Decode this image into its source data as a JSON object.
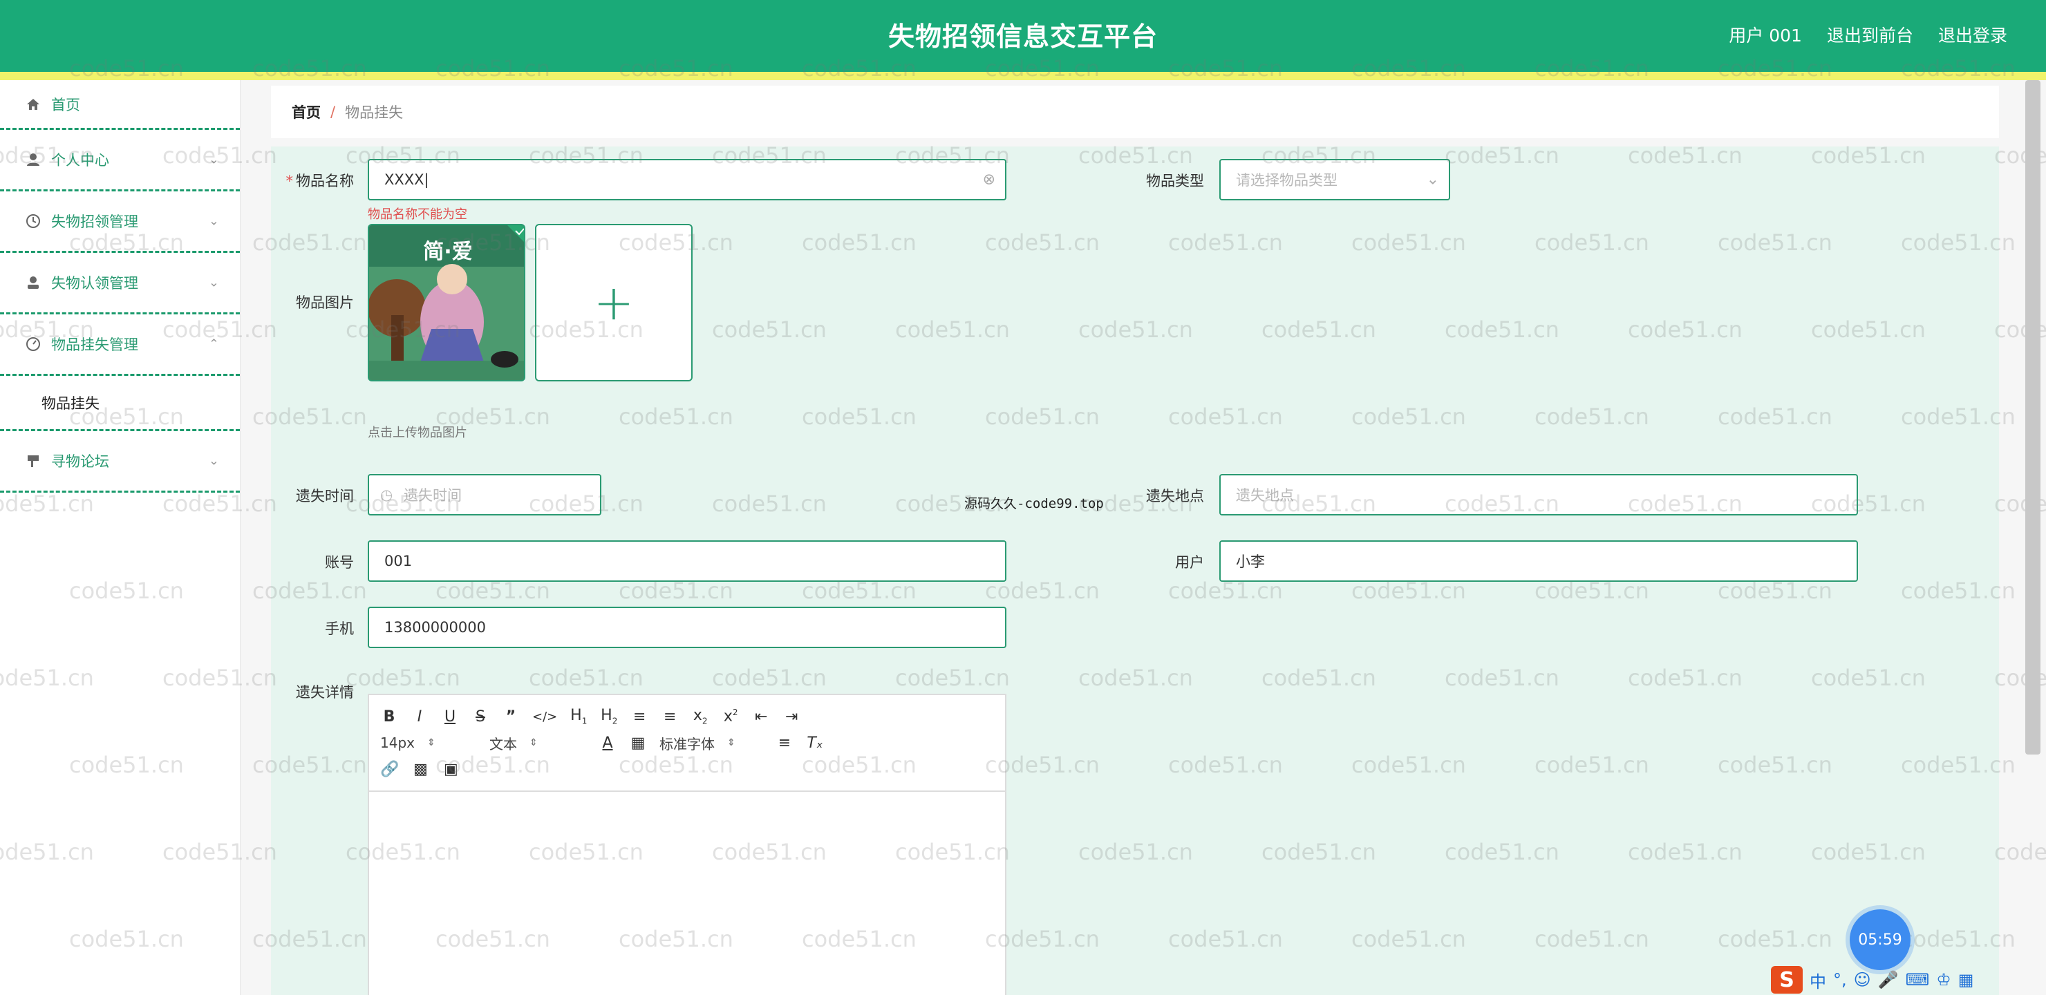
{
  "header": {
    "title": "失物招领信息交互平台",
    "links": [
      "用户 001",
      "退出到前台",
      "退出登录"
    ]
  },
  "sidebar": {
    "items": [
      {
        "label": "首页",
        "icon": "home-icon"
      },
      {
        "label": "个人中心",
        "icon": "user-icon"
      },
      {
        "label": "失物招领管理",
        "icon": "clock-icon"
      },
      {
        "label": "失物认领管理",
        "icon": "person-icon"
      },
      {
        "label": "物品挂失管理",
        "icon": "gauge-icon",
        "expanded": true
      },
      {
        "label": "物品挂失",
        "sub": true
      },
      {
        "label": "寻物论坛",
        "icon": "flag-icon"
      }
    ]
  },
  "breadcrumb": {
    "home": "首页",
    "separator": "/",
    "current": "物品挂失"
  },
  "form": {
    "name_label": "物品名称",
    "name_value": "XXXX",
    "name_error": "物品名称不能为空",
    "type_label": "物品类型",
    "type_placeholder": "请选择物品类型",
    "image_label": "物品图片",
    "image_hint": "点击上传物品图片",
    "thumb_title": "简·爱",
    "lost_time_label": "遗失时间",
    "lost_time_placeholder": "遗失时间",
    "lost_place_label": "遗失地点",
    "lost_place_placeholder": "遗失地点",
    "account_label": "账号",
    "account_value": "001",
    "user_label": "用户",
    "user_value": "小李",
    "phone_label": "手机",
    "phone_value": "13800000000",
    "detail_label": "遗失详情"
  },
  "editor": {
    "font_size": "14px",
    "text_style": "文本",
    "font_family": "标准字体"
  },
  "overlay": {
    "watermark": "code51.cn",
    "source_mark": "源码久久-code99.top",
    "clock": "05:59"
  },
  "ime": {
    "mode": "中"
  },
  "colors": {
    "primary": "#1aaa78",
    "accent_bar": "#f0f36a",
    "panel": "#e6f5ef",
    "error": "#e05050"
  }
}
